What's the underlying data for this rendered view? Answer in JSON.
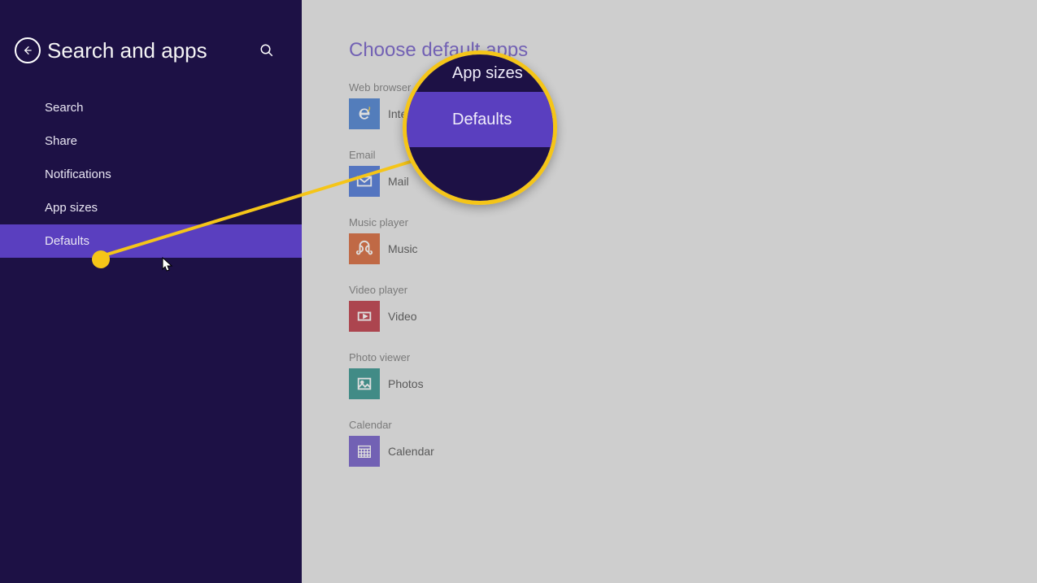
{
  "sidebar": {
    "title": "Search and apps",
    "items": [
      {
        "label": "Search"
      },
      {
        "label": "Share"
      },
      {
        "label": "Notifications"
      },
      {
        "label": "App sizes"
      },
      {
        "label": "Defaults"
      }
    ]
  },
  "main": {
    "title": "Choose default apps",
    "sections": [
      {
        "label": "Web browser",
        "app": "Internet Explorer",
        "appShort": "Inte"
      },
      {
        "label": "Email",
        "app": "Mail"
      },
      {
        "label": "Music player",
        "app": "Music"
      },
      {
        "label": "Video player",
        "app": "Video"
      },
      {
        "label": "Photo viewer",
        "app": "Photos"
      },
      {
        "label": "Calendar",
        "app": "Calendar"
      }
    ]
  },
  "callout": {
    "top": "App sizes",
    "mid": "Defaults"
  }
}
